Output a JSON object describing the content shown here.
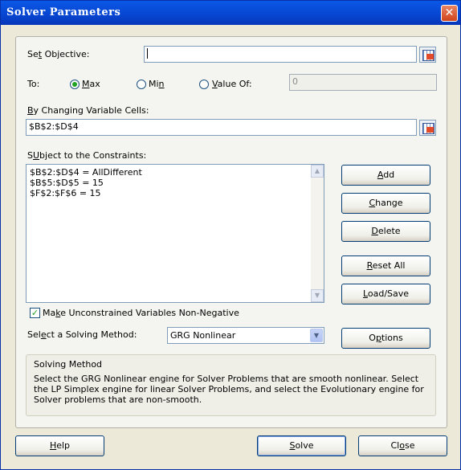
{
  "window": {
    "title": "Solver Parameters",
    "close_glyph": "✕"
  },
  "objective": {
    "label_u": "t",
    "label_pre": "Se",
    "label_post": " Objective:",
    "value": ""
  },
  "to": {
    "label": "To:",
    "max_u": "M",
    "max_rest": "ax",
    "min_pre": "Mi",
    "min_u": "n",
    "valueof_u": "V",
    "valueof_rest": "alue Of:",
    "selected": "Max",
    "value_of": "0"
  },
  "changing": {
    "label_u": "B",
    "label_rest": "y Changing Variable Cells:",
    "value": "$B$2:$D$4"
  },
  "constraints": {
    "label_u": "U",
    "label_pre": "S",
    "label_rest": "bject to the Constraints:",
    "items": [
      "$B$2:$D$4 = AllDifferent",
      "$B$5:$D$5 = 15",
      "$F$2:$F$6 = 15"
    ]
  },
  "buttons": {
    "add_u": "A",
    "add_rest": "dd",
    "change_u": "C",
    "change_rest": "hange",
    "delete_u": "D",
    "delete_rest": "elete",
    "reset_u": "R",
    "reset_rest": "eset All",
    "load_u": "L",
    "load_rest": "oad/Save",
    "options_u": "p",
    "options_pre": "O",
    "options_rest": "tions",
    "help_u": "H",
    "help_rest": "elp",
    "solve_u": "S",
    "solve_rest": "olve",
    "close_pre": "Cl",
    "close_u": "o",
    "close_rest": "se"
  },
  "nonneg": {
    "checked": true,
    "label_pre": "Ma",
    "label_u": "k",
    "label_rest": "e Unconstrained Variables Non-Negative"
  },
  "method": {
    "label_pre": "Sel",
    "label_u": "e",
    "label_rest": "ct a Solving Method:",
    "selected": "GRG Nonlinear"
  },
  "info": {
    "title": "Solving Method",
    "text": "Select the GRG Nonlinear engine for Solver Problems that are smooth nonlinear. Select the LP Simplex engine for linear Solver Problems, and select the Evolutionary engine for Solver problems that are non-smooth."
  },
  "icons": {
    "ref": "range-select-icon",
    "check_glyph": "✓",
    "up": "▲",
    "down": "▼"
  }
}
